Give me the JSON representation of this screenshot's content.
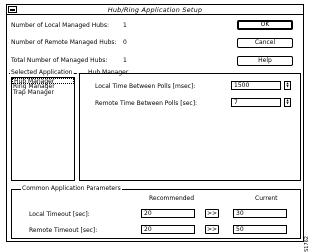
{
  "window": {
    "title": "Hub/Ring Application Setup"
  },
  "summary": {
    "local_hubs_label": "Number of Local Managed Hubs:",
    "local_hubs_value": "1",
    "remote_hubs_label": "Number of Remote Managed Hubs:",
    "remote_hubs_value": "0",
    "total_hubs_label": "Total Number of Managed Hubs:",
    "total_hubs_value": "1"
  },
  "buttons": {
    "ok": "OK",
    "cancel": "Cancel",
    "help": "Help"
  },
  "applications": {
    "label": "Selected Application",
    "items": [
      "Hub Manager",
      "Ring Manager",
      "Trap Manager"
    ],
    "selected_index": 0
  },
  "hub_manager": {
    "label": "Hub Manager",
    "local_time_label": "Local Time Between Polls [msec]:",
    "local_time_value": "1500",
    "remote_time_label": "Remote Time Between Polls [sec]:",
    "remote_time_value": "7"
  },
  "common": {
    "label": "Common Application Parameters",
    "recommended_header": "Recommended",
    "current_header": "Current",
    "local_timeout_label": "Local Timeout [sec]:",
    "local_timeout_recommended": "20",
    "local_timeout_current": "30",
    "remote_timeout_label": "Remote Timeout [sec]:",
    "remote_timeout_recommended": "20",
    "remote_timeout_current": "50",
    "copy_label": ">>"
  },
  "figure_id": "S1762"
}
